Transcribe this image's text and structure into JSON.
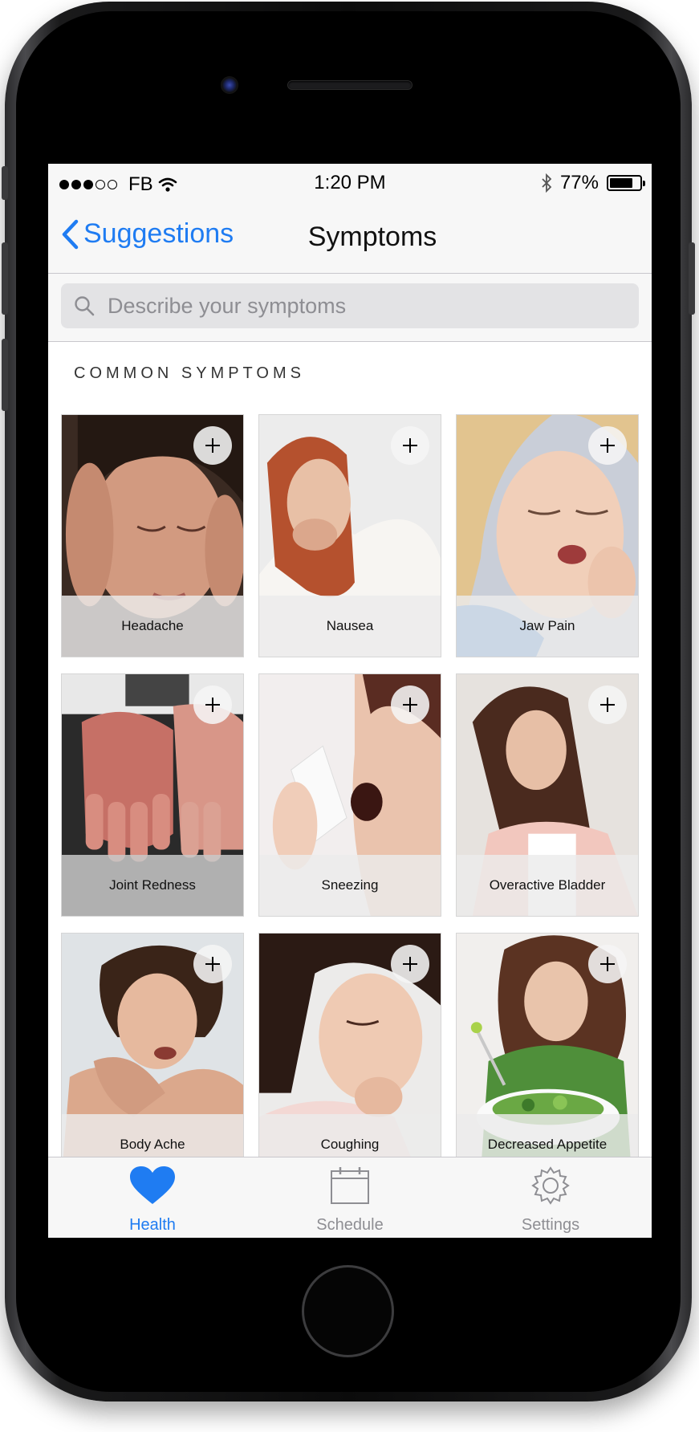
{
  "status_bar": {
    "carrier": "FB",
    "time": "1:20 PM",
    "battery_percent": "77%",
    "battery_level": 0.77,
    "signal_bars_filled": 3,
    "signal_bars_total": 5
  },
  "nav": {
    "back_label": "Suggestions",
    "title": "Symptoms"
  },
  "search": {
    "placeholder": "Describe your symptoms"
  },
  "section": {
    "title": "COMMON SYMPTOMS"
  },
  "symptoms": [
    {
      "name": "Headache"
    },
    {
      "name": "Nausea"
    },
    {
      "name": "Jaw Pain"
    },
    {
      "name": "Joint Redness"
    },
    {
      "name": "Sneezing"
    },
    {
      "name": "Overactive Bladder"
    },
    {
      "name": "Body Ache"
    },
    {
      "name": "Coughing"
    },
    {
      "name": "Decreased Appetite"
    }
  ],
  "tabs": [
    {
      "label": "Health",
      "active": true
    },
    {
      "label": "Schedule",
      "active": false
    },
    {
      "label": "Settings",
      "active": false
    }
  ],
  "colors": {
    "accent": "#1f7cf2",
    "inactive": "#8e8e93",
    "bar_background": "#f7f7f7"
  }
}
